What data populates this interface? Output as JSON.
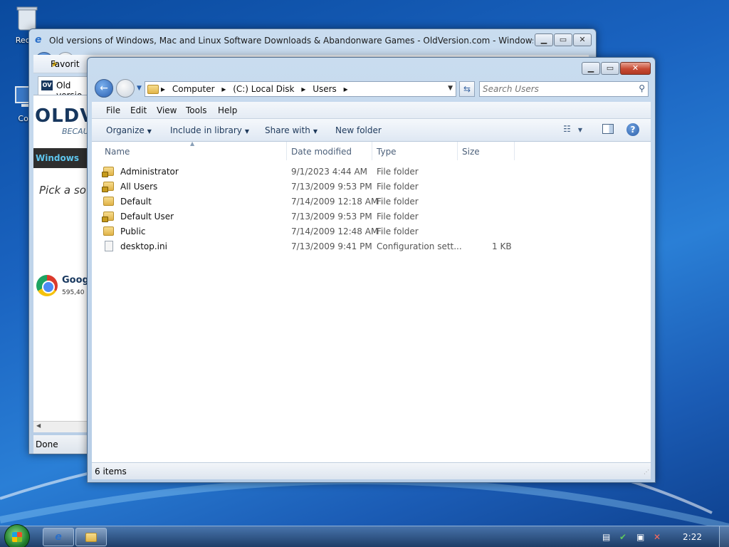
{
  "desktop": {
    "icons": [
      {
        "label": "Recyc",
        "icon": "recycle-bin-icon"
      },
      {
        "label": "Com",
        "icon": "computer-icon"
      }
    ]
  },
  "ie_window": {
    "title": "Old versions of Windows, Mac and Linux Software Downloads & Abandonware Games - OldVersion.com - Windows Interne...",
    "favorites_label": "Favorit",
    "tab_label": "Old versio",
    "tab_favicon": "OV",
    "page": {
      "logo": "OLDV",
      "tagline": "BECAU",
      "nav_label": "Windows",
      "pick_text": "Pick a sof",
      "app_name": "Goog",
      "app_downloads": "595,40"
    },
    "status": "Done"
  },
  "explorer": {
    "breadcrumb": [
      "Computer",
      "(C:) Local Disk",
      "Users"
    ],
    "search_placeholder": "Search Users",
    "menu": [
      "File",
      "Edit",
      "View",
      "Tools",
      "Help"
    ],
    "commands": {
      "organize": "Organize",
      "include": "Include in library",
      "share": "Share with",
      "new_folder": "New folder"
    },
    "columns": {
      "name": "Name",
      "date": "Date modified",
      "type": "Type",
      "size": "Size"
    },
    "rows": [
      {
        "name": "Administrator",
        "date": "9/1/2023 4:44 AM",
        "type": "File folder",
        "size": "",
        "icon": "folder-lock-icon"
      },
      {
        "name": "All Users",
        "date": "7/13/2009 9:53 PM",
        "type": "File folder",
        "size": "",
        "icon": "folder-lock-icon"
      },
      {
        "name": "Default",
        "date": "7/14/2009 12:18 AM",
        "type": "File folder",
        "size": "",
        "icon": "folder-icon"
      },
      {
        "name": "Default User",
        "date": "7/13/2009 9:53 PM",
        "type": "File folder",
        "size": "",
        "icon": "folder-lock-icon"
      },
      {
        "name": "Public",
        "date": "7/14/2009 12:48 AM",
        "type": "File folder",
        "size": "",
        "icon": "folder-icon"
      },
      {
        "name": "desktop.ini",
        "date": "7/13/2009 9:41 PM",
        "type": "Configuration sett...",
        "size": "1 KB",
        "icon": "file-icon"
      }
    ],
    "status": "6 items"
  },
  "taskbar": {
    "clock": "2:22"
  }
}
